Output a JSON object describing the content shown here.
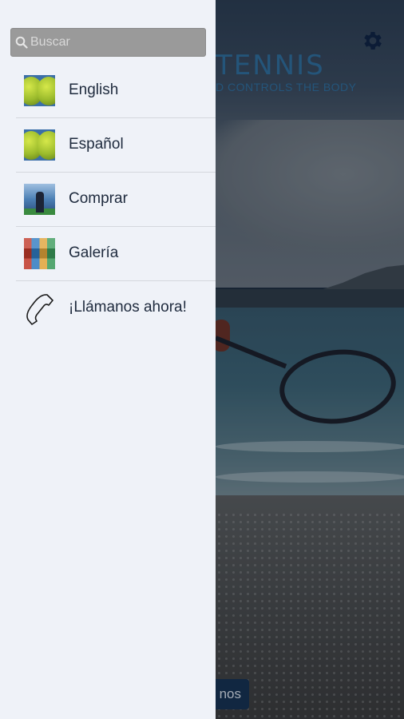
{
  "background": {
    "brand_title": "TENNIS",
    "brand_tagline": "D CONTROLS THE BODY",
    "bottom_button_label": "nos",
    "settings_icon": "gear-icon",
    "brand_color": "#2f6f9f"
  },
  "drawer": {
    "search": {
      "placeholder": "Buscar",
      "value": "",
      "icon": "search-icon"
    },
    "items": [
      {
        "label": "English",
        "icon": "tennis-balls-thumbnail"
      },
      {
        "label": "Español",
        "icon": "tennis-balls-thumbnail"
      },
      {
        "label": "Comprar",
        "icon": "player-photo-thumbnail"
      },
      {
        "label": "Galería",
        "icon": "gallery-collage-thumbnail"
      },
      {
        "label": "¡Llámanos ahora!",
        "icon": "phone-icon"
      }
    ],
    "colors": {
      "background": "#eff2f8",
      "text": "#1e2a3d",
      "divider": "#d4d7dd",
      "search_bg": "#9a9a9a"
    }
  }
}
